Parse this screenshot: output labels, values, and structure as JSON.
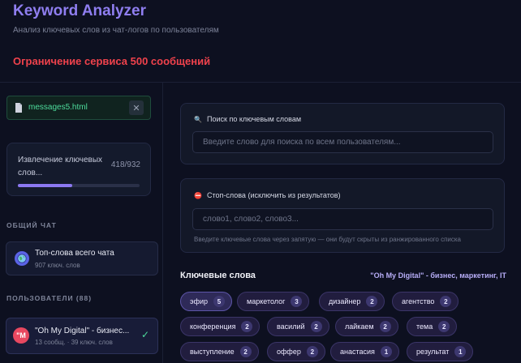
{
  "header": {
    "title": "Keyword Analyzer",
    "subtitle": "Анализ ключевых слов из чат-логов по пользователям",
    "limit_warning": "Ограничение сервиса 500 сообщений"
  },
  "sidebar": {
    "file": {
      "name": "messages5.html",
      "close_label": "✕"
    },
    "progress": {
      "label": "Извлечение ключевых слов...",
      "count": "418/932",
      "fraction": 0.449
    },
    "general_chat_heading": "ОБЩИЙ ЧАТ",
    "general_chat": {
      "title": "Топ-слова всего чата",
      "subtitle": "907 ключ. слов"
    },
    "users_heading": "ПОЛЬЗОВАТЕЛИ (88)",
    "selected_user": {
      "initials": "\"M",
      "title": "\"Oh My Digital\" - бизнес...",
      "subtitle": "13 сообщ. · 39 ключ. слов",
      "check": "✓"
    }
  },
  "search": {
    "label": "Поиск по ключевым словам",
    "icon": "🔍",
    "placeholder": "Введите слово для поиска по всем пользователям..."
  },
  "stopwords": {
    "label": "Стоп-слова (исключить из результатов)",
    "icon": "⛔",
    "placeholder": "слово1, слово2, слово3...",
    "hint": "Введите ключевые слова через запятую — они будут скрыты из ранжированного списка"
  },
  "keywords": {
    "title": "Ключевые слова",
    "user_label": "\"Oh My Digital\" - бизнес, маркетинг, IT",
    "tags": [
      {
        "word": "эфир",
        "count": "5"
      },
      {
        "word": "маркетолог",
        "count": "3"
      },
      {
        "word": "дизайнер",
        "count": "2"
      },
      {
        "word": "агентство",
        "count": "2"
      },
      {
        "word": "конференция",
        "count": "2"
      },
      {
        "word": "василий",
        "count": "2"
      },
      {
        "word": "лайкаем",
        "count": "2"
      },
      {
        "word": "тема",
        "count": "2"
      },
      {
        "word": "выступление",
        "count": "2"
      },
      {
        "word": "оффер",
        "count": "2"
      },
      {
        "word": "анастасия",
        "count": "1"
      },
      {
        "word": "результат",
        "count": "1"
      }
    ]
  },
  "colors": {
    "accent": "#8f7ef0",
    "warning": "#f0424c",
    "success": "#4ddc9c",
    "background": "#0d1020"
  }
}
